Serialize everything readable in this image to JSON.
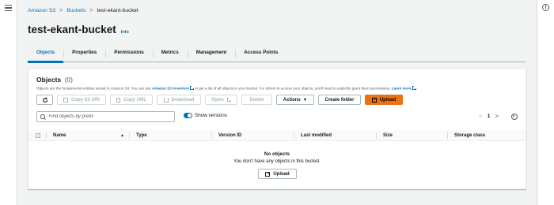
{
  "breadcrumb": {
    "items": [
      {
        "label": "Amazon S3"
      },
      {
        "label": "Buckets"
      },
      {
        "label": "test-ekant-bucket"
      }
    ],
    "separator": ">"
  },
  "page": {
    "title": "test-ekant-bucket",
    "info_label": "Info"
  },
  "tabs": [
    {
      "label": "Objects",
      "active": true
    },
    {
      "label": "Properties"
    },
    {
      "label": "Permissions"
    },
    {
      "label": "Metrics"
    },
    {
      "label": "Management"
    },
    {
      "label": "Access Points"
    }
  ],
  "objects_panel": {
    "title": "Objects",
    "count": "(0)",
    "description_prefix": "Objects are the fundamental entities stored in Amazon S3. You can use",
    "inventory_link": "Amazon S3 inventory",
    "description_middle": "to get a list of all objects in your bucket. For others to access your objects, you'll need to explicitly grant them permissions.",
    "learn_more": "Learn more",
    "toolbar": {
      "copy_s3_uri": "Copy S3 URI",
      "copy_url": "Copy URL",
      "download": "Download",
      "open": "Open",
      "delete": "Delete",
      "actions": "Actions",
      "create_folder": "Create folder",
      "upload": "Upload"
    },
    "search": {
      "placeholder": "Find objects by prefix",
      "value": ""
    },
    "show_versions": {
      "label": "Show versions",
      "enabled": true
    },
    "pagination": {
      "page": "1",
      "prev": "<",
      "next": ">"
    },
    "columns": [
      "Name",
      "Type",
      "Version ID",
      "Last modified",
      "Size",
      "Storage class"
    ],
    "sort_indicator": "▲",
    "empty_state": {
      "title": "No objects",
      "description": "You don't have any objects in this bucket.",
      "upload_label": "Upload"
    }
  },
  "colors": {
    "link": "#0073bb",
    "primary_button": "#ec7211",
    "background": "#f2f3f3"
  },
  "icons": [
    "menu-icon",
    "info-circle-icon",
    "refresh-icon",
    "copy-icon",
    "download-icon",
    "external-link-icon",
    "caret-down-icon",
    "upload-icon",
    "search-icon",
    "settings-gear-icon",
    "sort-ascending-icon"
  ]
}
